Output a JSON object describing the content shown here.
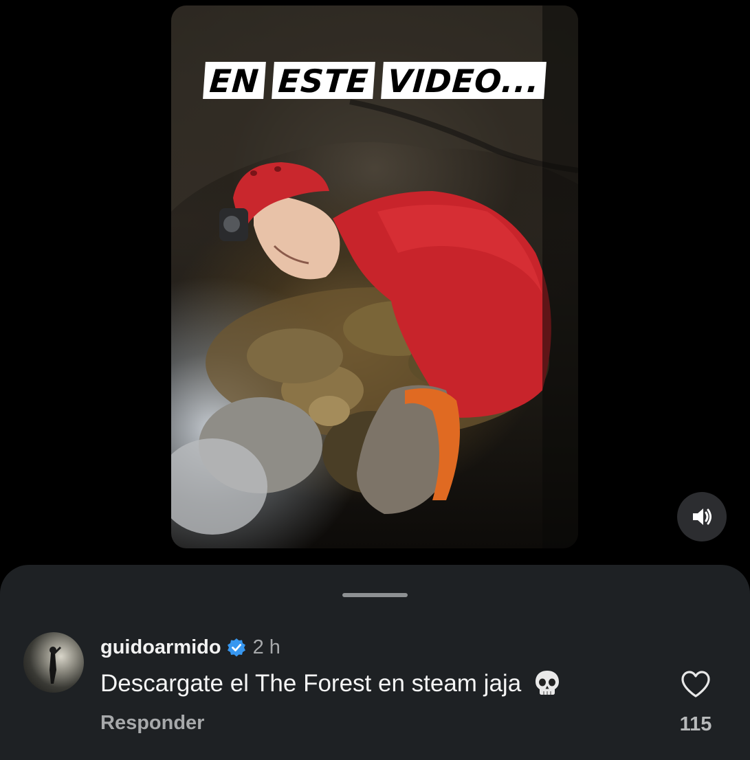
{
  "video": {
    "caption_words": [
      "EN",
      "ESTE",
      "VIDEO..."
    ],
    "mute_icon": "speaker-muted-icon"
  },
  "comment": {
    "username": "guidoarmido",
    "verified_icon": "verified-badge-icon",
    "timestamp": "2 h",
    "text": "Descargate el The Forest en steam jaja",
    "emoji": "skull-emoji",
    "reply_label": "Responder",
    "like_icon": "heart-outline-icon",
    "like_count": "115"
  },
  "colors": {
    "background": "#000000",
    "sheet": "#1e2124",
    "verified": "#3797f0",
    "muted_text": "#a7a9ab"
  }
}
